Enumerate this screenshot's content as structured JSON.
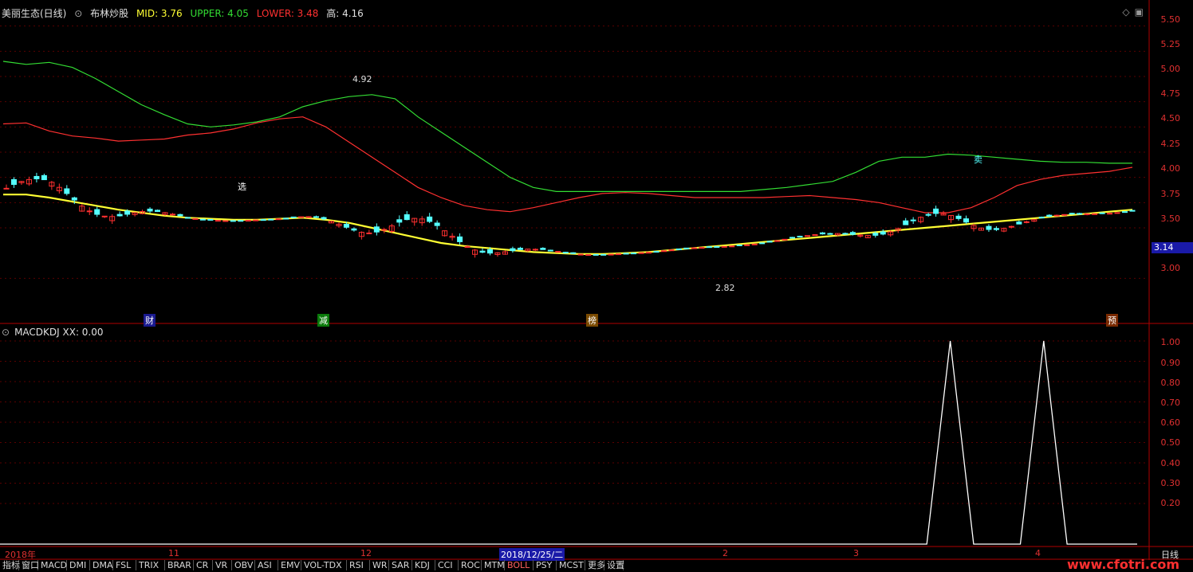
{
  "header": {
    "stock_name": "美丽生态(日线)",
    "indicator_name": "布林炒股",
    "mid": "MID: 3.76",
    "upper": "UPPER: 4.05",
    "lower": "LOWER: 3.48",
    "high": "高: 4.16"
  },
  "sub_header": {
    "label": "MACDKDJ XX: 0.00"
  },
  "colors": {
    "mid": "#ffff33",
    "upper": "#33dd33",
    "lower": "#ff3030",
    "up_candle": "#ff3030",
    "down_candle": "#54ffff",
    "axis": "#b00000"
  },
  "price_axis": [
    "5.50",
    "5.25",
    "5.00",
    "4.75",
    "4.50",
    "4.25",
    "4.00",
    "3.75",
    "3.50",
    "3.00"
  ],
  "current_price": "3.14",
  "sub_axis": [
    "1.00",
    "0.90",
    "0.80",
    "0.70",
    "0.60",
    "0.50",
    "0.40",
    "0.30",
    "0.20"
  ],
  "date_axis": {
    "start": "2018年",
    "m11": "11",
    "m12": "12",
    "cursor_date": "2018/12/25/二",
    "m2": "2",
    "m3": "3",
    "m4": "4",
    "period": "日线"
  },
  "annotations": {
    "high_label": "4.92",
    "low_label": "2.82",
    "select": "选",
    "sell": "卖",
    "tag_cai": "财",
    "tag_jian": "减",
    "tag_bang": "榜",
    "tag_yu": "预"
  },
  "tabs": [
    "指标",
    "窗口",
    "MACD",
    "DMI",
    "DMA",
    "FSL",
    "TRIX",
    "BRAR",
    "CR",
    "VR",
    "OBV",
    "ASI",
    "EMV",
    "VOL-TDX",
    "RSI",
    "WR",
    "SAR",
    "KDJ",
    "CCI",
    "ROC",
    "MTM",
    "BOLL",
    "PSY",
    "MCST",
    "更多",
    "设置"
  ],
  "watermark": "www.cfotri.com",
  "chart_data": [
    {
      "type": "line",
      "title": "",
      "y_range": [
        2.6,
        5.6
      ],
      "series": [
        {
          "name": "MID",
          "values": [
            3.83,
            3.83,
            3.8,
            3.76,
            3.72,
            3.68,
            3.65,
            3.62,
            3.6,
            3.59,
            3.58,
            3.58,
            3.59,
            3.6,
            3.58,
            3.55,
            3.5,
            3.45,
            3.4,
            3.35,
            3.32,
            3.3,
            3.28,
            3.26,
            3.25,
            3.24,
            3.24,
            3.25,
            3.26,
            3.28,
            3.3,
            3.32,
            3.34,
            3.36,
            3.38,
            3.4,
            3.42,
            3.44,
            3.46,
            3.48,
            3.5,
            3.52,
            3.54,
            3.56,
            3.58,
            3.6,
            3.62,
            3.64,
            3.66,
            3.68
          ]
        },
        {
          "name": "UPPER",
          "values": [
            5.15,
            5.12,
            5.14,
            5.09,
            4.98,
            4.85,
            4.72,
            4.62,
            4.53,
            4.5,
            4.52,
            4.55,
            4.6,
            4.7,
            4.76,
            4.8,
            4.82,
            4.78,
            4.6,
            4.45,
            4.3,
            4.15,
            4.0,
            3.9,
            3.86,
            3.86,
            3.86,
            3.86,
            3.86,
            3.86,
            3.86,
            3.86,
            3.86,
            3.88,
            3.9,
            3.93,
            3.96,
            4.05,
            4.16,
            4.2,
            4.2,
            4.23,
            4.22,
            4.2,
            4.18,
            4.16,
            4.15,
            4.15,
            4.14,
            4.14
          ]
        },
        {
          "name": "LOWER",
          "values": [
            4.53,
            4.54,
            4.46,
            4.41,
            4.39,
            4.36,
            4.37,
            4.38,
            4.42,
            4.44,
            4.48,
            4.54,
            4.58,
            4.6,
            4.5,
            4.35,
            4.2,
            4.05,
            3.9,
            3.8,
            3.72,
            3.68,
            3.66,
            3.7,
            3.75,
            3.8,
            3.84,
            3.85,
            3.84,
            3.82,
            3.8,
            3.8,
            3.8,
            3.8,
            3.81,
            3.82,
            3.8,
            3.78,
            3.75,
            3.7,
            3.65,
            3.65,
            3.7,
            3.8,
            3.92,
            3.98,
            4.02,
            4.04,
            4.06,
            4.1
          ]
        },
        {
          "name": "XX",
          "values": [
            0,
            0,
            0,
            0,
            0,
            0,
            0,
            0,
            0,
            0,
            0,
            0,
            0,
            0,
            0,
            0,
            0,
            0,
            0,
            0,
            0,
            0,
            0,
            0,
            0,
            0,
            0,
            0,
            0,
            0,
            0,
            0,
            0,
            0,
            0,
            0,
            0,
            0,
            0,
            0,
            0,
            1,
            0,
            0,
            0,
            1,
            0,
            0,
            0,
            0
          ]
        }
      ]
    }
  ]
}
